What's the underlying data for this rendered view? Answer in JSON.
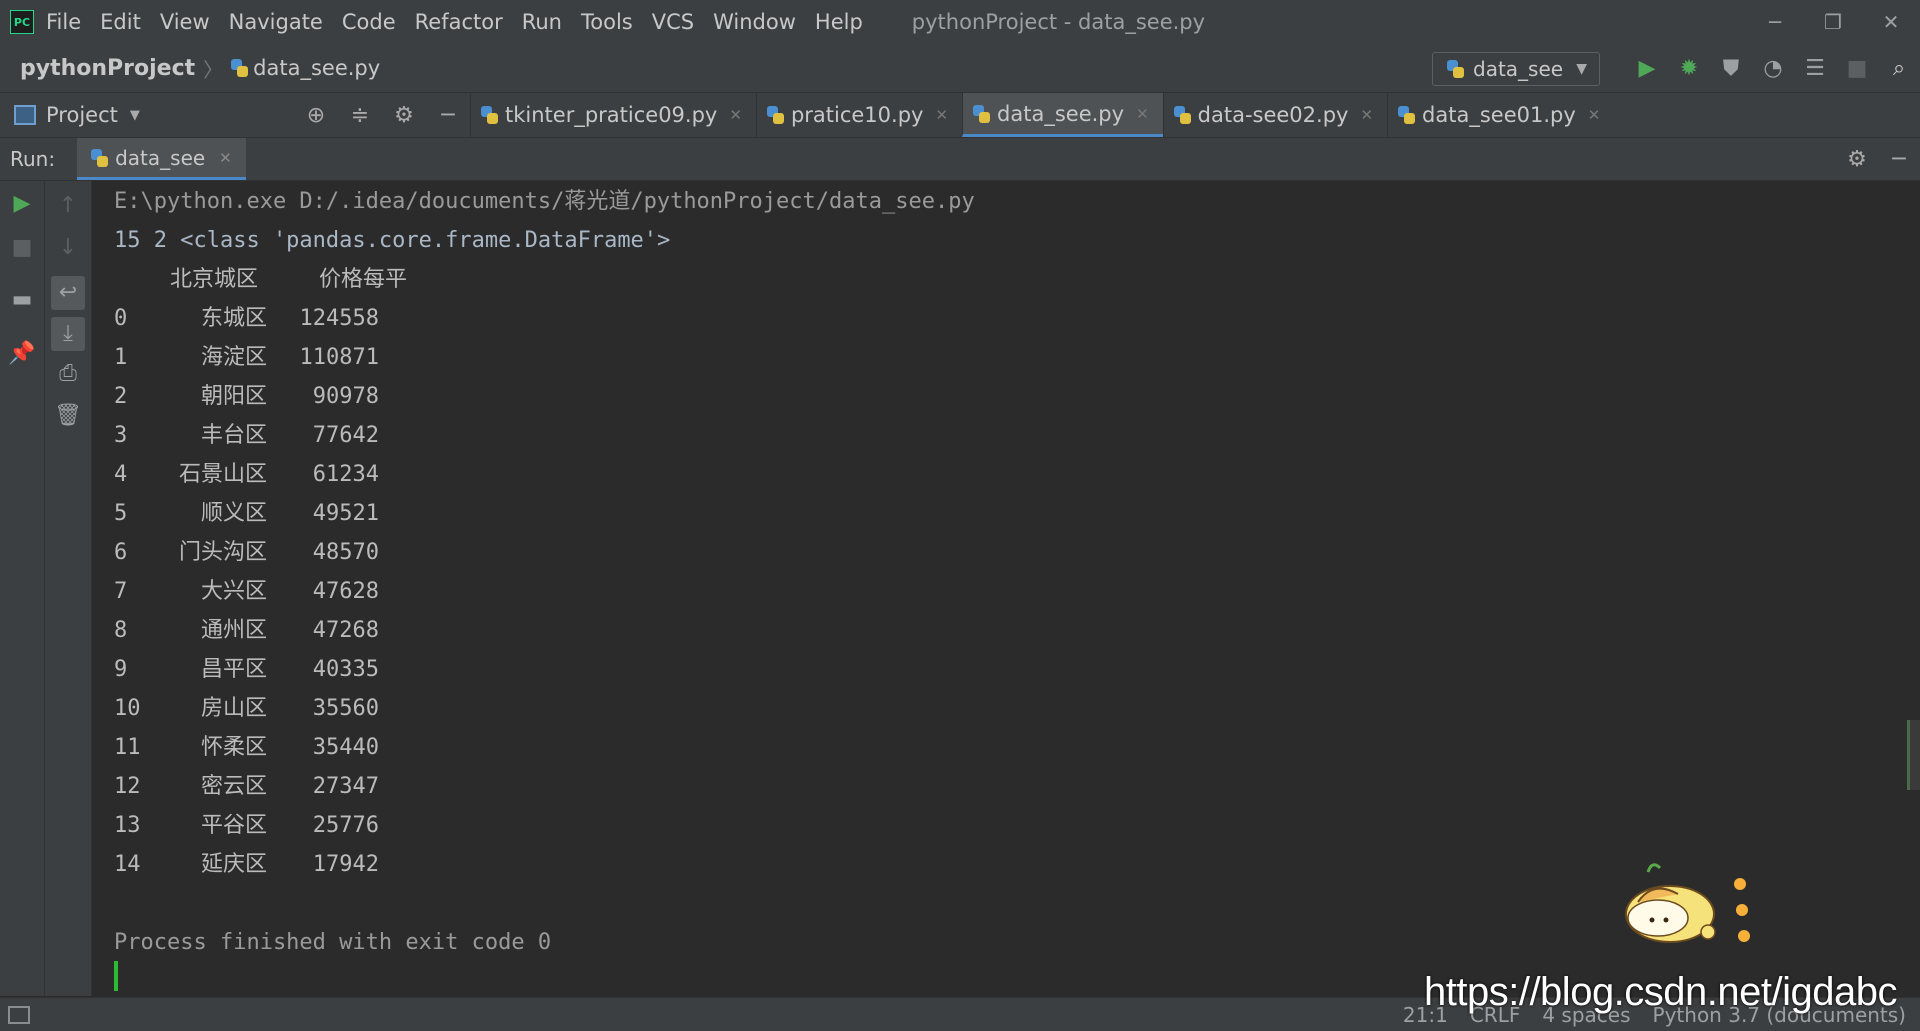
{
  "menu": {
    "app_logo_text": "PC",
    "items": [
      "File",
      "Edit",
      "View",
      "Navigate",
      "Code",
      "Refactor",
      "Run",
      "Tools",
      "VCS",
      "Window",
      "Help"
    ],
    "window_title": "pythonProject - data_see.py"
  },
  "navbar": {
    "project": "pythonProject",
    "file": "data_see.py",
    "run_config": "data_see"
  },
  "project_pane": {
    "label": "Project"
  },
  "tabs": [
    {
      "label": "tkinter_pratice09.py",
      "active": false
    },
    {
      "label": "pratice10.py",
      "active": false
    },
    {
      "label": "data_see.py",
      "active": true
    },
    {
      "label": "data-see02.py",
      "active": false
    },
    {
      "label": "data_see01.py",
      "active": false
    }
  ],
  "run_panel": {
    "label": "Run:",
    "tab": "data_see"
  },
  "console": {
    "command": "E:\\python.exe D:/.idea/doucuments/蒋光道/pythonProject/data_see.py",
    "info_line": "15 2 <class 'pandas.core.frame.DataFrame'>",
    "columns": [
      "北京城区",
      "价格每平"
    ],
    "rows": [
      {
        "idx": "0",
        "district": "东城区",
        "price": "124558"
      },
      {
        "idx": "1",
        "district": "海淀区",
        "price": "110871"
      },
      {
        "idx": "2",
        "district": "朝阳区",
        "price": "90978"
      },
      {
        "idx": "3",
        "district": "丰台区",
        "price": "77642"
      },
      {
        "idx": "4",
        "district": "石景山区",
        "price": "61234"
      },
      {
        "idx": "5",
        "district": "顺义区",
        "price": "49521"
      },
      {
        "idx": "6",
        "district": "门头沟区",
        "price": "48570"
      },
      {
        "idx": "7",
        "district": "大兴区",
        "price": "47628"
      },
      {
        "idx": "8",
        "district": "通州区",
        "price": "47268"
      },
      {
        "idx": "9",
        "district": "昌平区",
        "price": "40335"
      },
      {
        "idx": "10",
        "district": "房山区",
        "price": "35560"
      },
      {
        "idx": "11",
        "district": "怀柔区",
        "price": "35440"
      },
      {
        "idx": "12",
        "district": "密云区",
        "price": "27347"
      },
      {
        "idx": "13",
        "district": "平谷区",
        "price": "25776"
      },
      {
        "idx": "14",
        "district": "延庆区",
        "price": "17942"
      }
    ],
    "finish_line": "Process finished with exit code 0"
  },
  "status": {
    "position": "21:1",
    "line_sep": "CRLF",
    "indent": "4 spaces",
    "interpreter": "Python 3.7 (doucuments)"
  },
  "watermark": "https://blog.csdn.net/igdabc",
  "colors": {
    "background": "#2b2b2b",
    "panel": "#3c3f41",
    "active_tab_underline": "#4a88c7",
    "run_green": "#4fa857",
    "cursor_green": "#2dbb32"
  }
}
